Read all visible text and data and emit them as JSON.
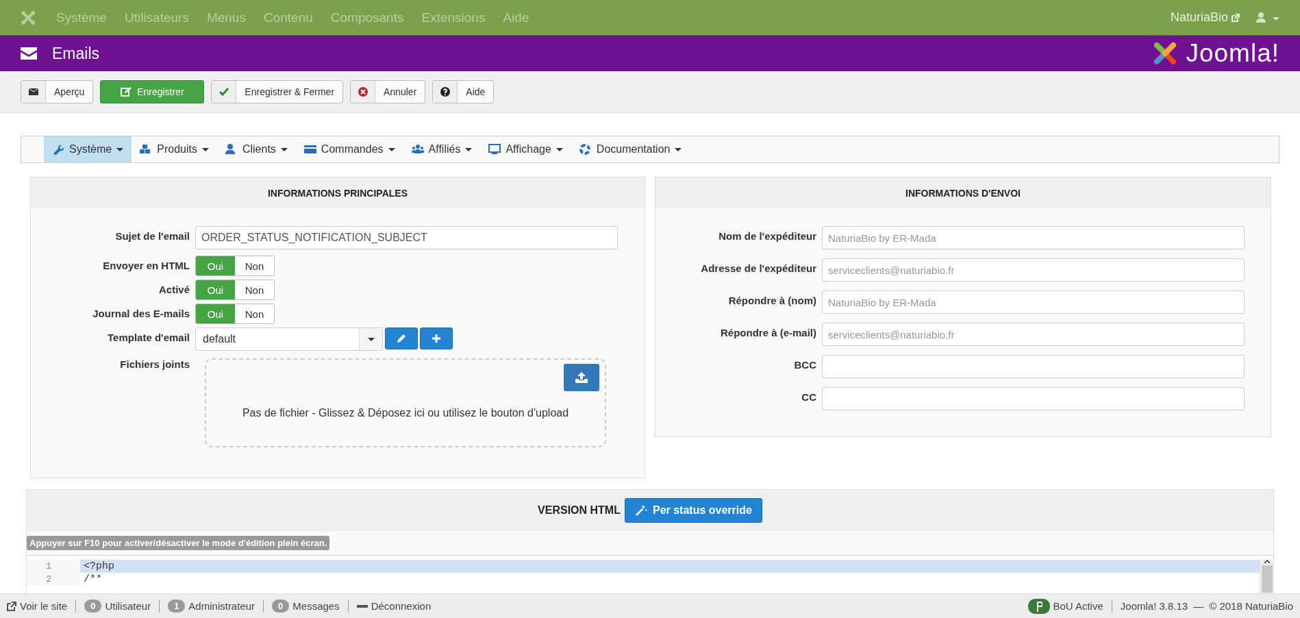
{
  "top_menu": {
    "items": [
      {
        "label": "Système"
      },
      {
        "label": "Utilisateurs"
      },
      {
        "label": "Menus"
      },
      {
        "label": "Contenu"
      },
      {
        "label": "Composants"
      },
      {
        "label": "Extensions"
      },
      {
        "label": "Aide"
      }
    ],
    "site_link": "NaturiaBio"
  },
  "header": {
    "title": "Emails",
    "logo": "Joomla!"
  },
  "toolbar": [
    {
      "label": "Aperçu",
      "kind": "preview"
    },
    {
      "label": "Enregistrer",
      "kind": "save"
    },
    {
      "label": "Enregistrer & Fermer",
      "kind": "save_close"
    },
    {
      "label": "Annuler",
      "kind": "cancel"
    },
    {
      "label": "Aide",
      "kind": "help"
    }
  ],
  "component_menu": [
    {
      "label": "Système",
      "kind": "wrench",
      "selected": true
    },
    {
      "label": "Produits",
      "kind": "cubes",
      "selected": false
    },
    {
      "label": "Clients",
      "kind": "user",
      "selected": false
    },
    {
      "label": "Commandes",
      "kind": "card",
      "selected": false
    },
    {
      "label": "Affiliés",
      "kind": "users",
      "selected": false
    },
    {
      "label": "Affichage",
      "kind": "monitor",
      "selected": false
    },
    {
      "label": "Documentation",
      "kind": "lifebuoy",
      "selected": false
    }
  ],
  "main_info": {
    "title": "INFORMATIONS PRINCIPALES",
    "subject": {
      "label": "Sujet de l'email",
      "value": "ORDER_STATUS_NOTIFICATION_SUBJECT"
    },
    "toggles": [
      {
        "label": "Envoyer en HTML",
        "options": [
          {
            "label": "Oui",
            "selected": true
          },
          {
            "label": "Non",
            "selected": false
          }
        ]
      },
      {
        "label": "Activé",
        "options": [
          {
            "label": "Oui",
            "selected": true
          },
          {
            "label": "Non",
            "selected": false
          }
        ]
      },
      {
        "label": "Journal des E-mails",
        "options": [
          {
            "label": "Oui",
            "selected": true
          },
          {
            "label": "Non",
            "selected": false
          }
        ]
      }
    ],
    "template": {
      "label": "Template d'email",
      "value": "default"
    },
    "attachments": {
      "label": "Fichiers joints",
      "message": "Pas de fichier - Glissez & Déposez ici ou utilisez le bouton d'upload"
    }
  },
  "sending_info": {
    "title": "INFORMATIONS D'ENVOI",
    "fields": [
      {
        "label": "Nom de l'expéditeur",
        "placeholder": "NaturiaBio by ER-Mada"
      },
      {
        "label": "Adresse de l'expéditeur",
        "placeholder": "serviceclients@naturiabio.fr"
      },
      {
        "label": "Répondre à (nom)",
        "placeholder": "NaturiaBio by ER-Mada"
      },
      {
        "label": "Répondre à (e-mail)",
        "placeholder": "serviceclients@naturiabio.fr"
      },
      {
        "label": "BCC"
      },
      {
        "label": "CC"
      }
    ]
  },
  "html_version": {
    "title": "VERSION HTML",
    "button": "Per status override",
    "notice": "Appuyer sur F10 pour activer/désactiver le mode d'édition plein écran.",
    "code": [
      {
        "number": "1",
        "text": "<?php",
        "highlighted": true
      },
      {
        "number": "2",
        "text": "/**",
        "highlighted": false
      }
    ]
  },
  "status_bar": {
    "left": [
      {
        "kind": "link",
        "label": "Voir le site"
      },
      {
        "kind": "count",
        "count": "0",
        "label": "Utilisateur"
      },
      {
        "kind": "count",
        "count": "1",
        "label": "Administrateur"
      },
      {
        "kind": "count",
        "count": "0",
        "label": "Messages"
      },
      {
        "kind": "logout",
        "label": "Déconnexion"
      }
    ],
    "bou": "BoU Active",
    "version": "Joomla! 3.8.13",
    "dash": "—",
    "copyright": "© 2018 NaturiaBio"
  }
}
